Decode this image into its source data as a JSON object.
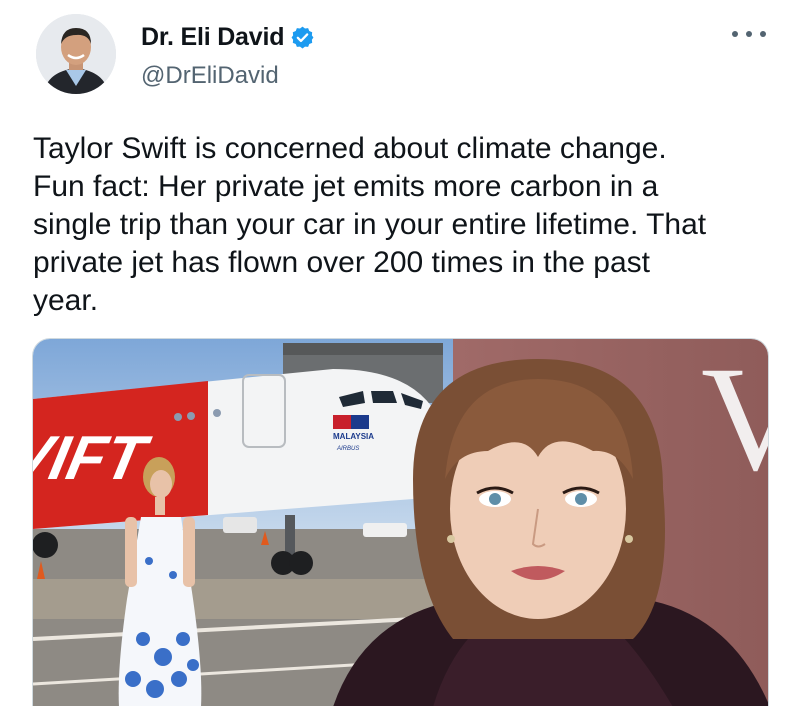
{
  "author": {
    "display_name": "Dr. Eli David",
    "handle": "@DrEliDavid",
    "verified": true,
    "avatar_icon": "profile-photo"
  },
  "more_icon": "ellipsis-icon",
  "tweet": {
    "text": "Taylor Swift is concerned about climate change.\nFun fact: Her private jet emits more carbon in a\nsingle trip than your car in your entire lifetime. That\nprivate jet has flown over 200 times in the past\nyear."
  },
  "media": {
    "airplane_livery": "VIFT",
    "registration_flag_text": "MALAYSIA",
    "airbus_text": "AIRBUS",
    "backdrop_letter": "V"
  },
  "colors": {
    "verified_blue": "#1d9bf0",
    "handle_gray": "#536471",
    "jet_red": "#d4251f"
  }
}
